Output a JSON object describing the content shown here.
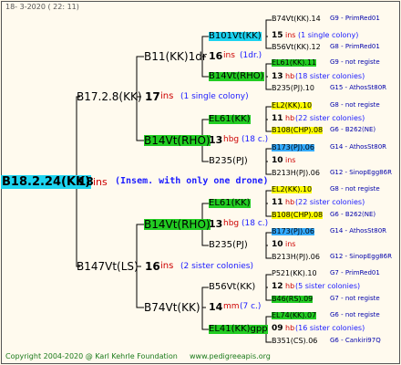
{
  "header": {
    "date": "18-  3-2020 ( 22: 11)"
  },
  "root": {
    "name": "B18.2.24(KK)",
    "count": "18",
    "unit": "ins",
    "note": "(Insem. with only one drone)"
  },
  "gen1": [
    {
      "name": "B17.2.8(KK)",
      "count": "17",
      "unit": "ins",
      "note": "(1 single colony)"
    },
    {
      "name": "B147Vt(LS)",
      "count": "16",
      "unit": "ins",
      "note": "(2 sister colonies)"
    }
  ],
  "gen2": [
    {
      "name": "B11(KK)1dr",
      "count": "16",
      "unit": "ins",
      "note": "(1dr.)"
    },
    {
      "name": "B14Vt(RHO)",
      "count": "13",
      "unit": "hbg",
      "note": "(18 c.)"
    },
    {
      "name": "B14Vt(RHO)",
      "count": "13",
      "unit": "hbg",
      "note": "(18 c.)"
    },
    {
      "name": "B74Vt(KK)",
      "count": "14",
      "unit": "mm",
      "note": "(7 c.)"
    }
  ],
  "gen3": [
    {
      "name": "B101Vt(KK)",
      "count": "15",
      "unit": "ins",
      "note": "(1 single colony)"
    },
    {
      "name": "B14Vt(RHO)",
      "count": "",
      "unit": "",
      "note": ""
    },
    {
      "name": "EL61(KK)",
      "count": "",
      "unit": "",
      "note": ""
    },
    {
      "name": "B235(PJ)",
      "count": "",
      "unit": "",
      "note": ""
    },
    {
      "name": "EL61(KK)",
      "count": "",
      "unit": "",
      "note": ""
    },
    {
      "name": "B235(PJ)",
      "count": "",
      "unit": "",
      "note": ""
    },
    {
      "name": "B56Vt(KK)",
      "count": "12",
      "unit": "hb",
      "note": "(5 sister colonies)"
    },
    {
      "name": "EL41(KK)gpp",
      "count": "",
      "unit": "",
      "note": ""
    }
  ],
  "gen4": [
    {
      "name": "B74Vt(KK).14",
      "info": "G9 - PrimRed01"
    },
    {
      "name": "B56Vt(KK).12",
      "info": "G8 - PrimRed01"
    },
    {
      "name": "EL61(KK).11",
      "info": "G9 - not registe"
    },
    {
      "name": "B235(PJ).10",
      "info": "G15 - AthosSt80R"
    },
    {
      "name": "EL2(KK).10",
      "info": "G8 - not registe"
    },
    {
      "name": "B108(CHP).08",
      "info": "G6 - B262(NE)"
    },
    {
      "name": "B173(PJ).06",
      "info": "G14 - AthosSt80R"
    },
    {
      "name": "B213H(PJ).06",
      "info": "G12 - SinopEgg86R"
    },
    {
      "name": "EL2(KK).10",
      "info": "G8 - not registe"
    },
    {
      "name": "B108(CHP).08",
      "info": "G6 - B262(NE)"
    },
    {
      "name": "B173(PJ).06",
      "info": "G14 - AthosSt80R"
    },
    {
      "name": "B213H(PJ).06",
      "info": "G12 - SinopEgg86R"
    },
    {
      "name": "P521(KK).10",
      "info": "G7 - PrimRed01"
    },
    {
      "name": "B46(RS).09",
      "info": "G7 - not registe"
    },
    {
      "name": "EL74(KK).07",
      "info": "G6 - not registe"
    },
    {
      "name": "B351(CS).06",
      "info": "G6 - Cankiri97Q"
    }
  ],
  "gen4_counts": [
    {
      "count": "15",
      "unit": "ins",
      "note": "(1 single colony)"
    },
    {
      "count": "13",
      "unit": "hb",
      "note": "(18 sister colonies)"
    },
    {
      "count": "11",
      "unit": "hb",
      "note": "(22 sister colonies)"
    },
    {
      "count": "10",
      "unit": "ins",
      "note": ""
    },
    {
      "count": "11",
      "unit": "hb",
      "note": "(22 sister colonies)"
    },
    {
      "count": "10",
      "unit": "ins",
      "note": ""
    },
    {
      "count": "12",
      "unit": "hb",
      "note": "(5 sister colonies)"
    },
    {
      "count": "09",
      "unit": "hb",
      "note": "(16 sister colonies)"
    }
  ],
  "footer": {
    "copyright": "Copyright 2004-2020 @ Karl Kehrle Foundation",
    "url": "www.pedigreeapis.org"
  },
  "colors": {
    "cyan": "#1cd3f0",
    "green": "#22cc22",
    "yellow": "#ffff00",
    "light_blue": "#33aaff",
    "red": "#cc0000",
    "blue": "#1a1aff"
  }
}
